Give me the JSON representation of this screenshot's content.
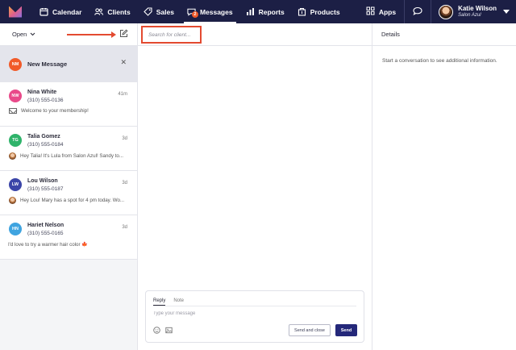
{
  "nav": {
    "items": [
      {
        "label": "Calendar",
        "icon": "calendar-icon"
      },
      {
        "label": "Clients",
        "icon": "clients-icon"
      },
      {
        "label": "Sales",
        "icon": "tag-icon"
      },
      {
        "label": "Messages",
        "icon": "messages-icon",
        "badge": "2",
        "active": true
      },
      {
        "label": "Reports",
        "icon": "reports-icon"
      },
      {
        "label": "Products",
        "icon": "products-icon"
      }
    ],
    "apps_label": "Apps",
    "user_name": "Katie Wilson",
    "user_business": "Salon Azul"
  },
  "left": {
    "filter_label": "Open",
    "new_message": {
      "initials": "NM",
      "label": "New Message",
      "color": "#f15a29"
    },
    "conversations": [
      {
        "initials": "NW",
        "color": "#e94a8a",
        "name": "Nina White",
        "phone": "(310) 555-0136",
        "time": "41m",
        "preview": "Welcome to your membership!",
        "preview_icon": "envelope-icon"
      },
      {
        "initials": "TG",
        "color": "#2fb36a",
        "name": "Talia Gomez",
        "phone": "(310) 555-0184",
        "time": "3d",
        "preview": "Hey Talia! It's Lula from Salon Azul! Sandy to...",
        "preview_icon": "staff-avatar"
      },
      {
        "initials": "LW",
        "color": "#3b45a8",
        "name": "Lou Wilson",
        "phone": "(310) 555-0187",
        "time": "3d",
        "preview": "Hey Lou! Mary has a spot for 4 pm today. Wo...",
        "preview_icon": "staff-avatar"
      },
      {
        "initials": "HN",
        "color": "#3fa4e0",
        "name": "Hariet Nelson",
        "phone": "(310) 555-0165",
        "time": "3d",
        "preview": "I'd love to try a warmer hair color 🍁",
        "preview_icon": ""
      }
    ]
  },
  "middle": {
    "search_placeholder": "Search for client...",
    "composer": {
      "tab_reply": "Reply",
      "tab_note": "Note",
      "placeholder": "Type your message",
      "send_close_label": "Send and close",
      "send_label": "Send"
    }
  },
  "right": {
    "title": "Details",
    "body": "Start a conversation to see additional information."
  },
  "colors": {
    "nav_bg": "#1c1f45",
    "accent": "#24287a",
    "highlight": "#e34a30"
  }
}
